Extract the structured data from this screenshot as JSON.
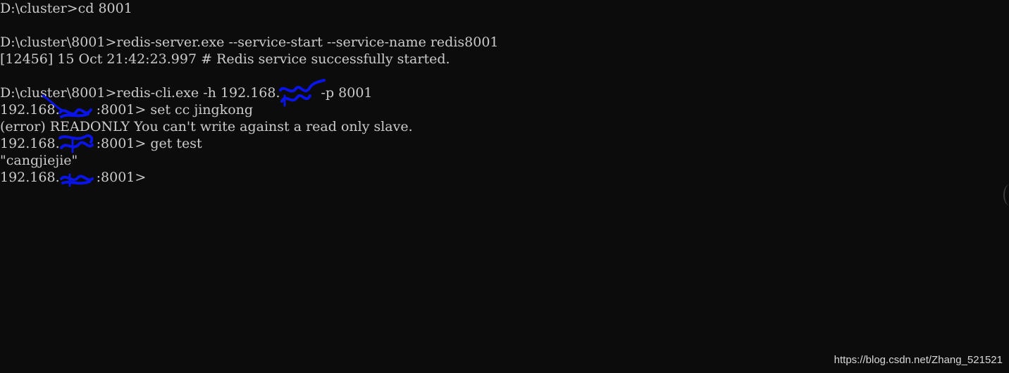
{
  "terminal": {
    "lines": [
      {
        "text": "D:\\cluster>cd 8001"
      },
      {
        "text": ""
      },
      {
        "text": "D:\\cluster\\8001>redis-server.exe --service-start --service-name redis8001"
      },
      {
        "text": "[12456] 15 Oct 21:42:23.997 # Redis service successfully started."
      },
      {
        "text": ""
      },
      {
        "pre": "D:\\cluster\\8001>redis-cli.exe -h 192.168.",
        "post": " -p 8001"
      },
      {
        "pre": "192.168.",
        "post": ":8001> set cc jingkong"
      },
      {
        "text": "(error) READONLY You can't write against a read only slave."
      },
      {
        "pre": "192.168.",
        "post": ":8001> get test"
      },
      {
        "text": "\"cangjiejie\""
      },
      {
        "pre": "192.168.",
        "post": ":8001>"
      }
    ]
  },
  "watermark": "https://blog.csdn.net/Zhang_521521",
  "colors": {
    "background": "#0c0c0c",
    "text": "#cccccc",
    "redaction_ink": "#0a14e6"
  }
}
